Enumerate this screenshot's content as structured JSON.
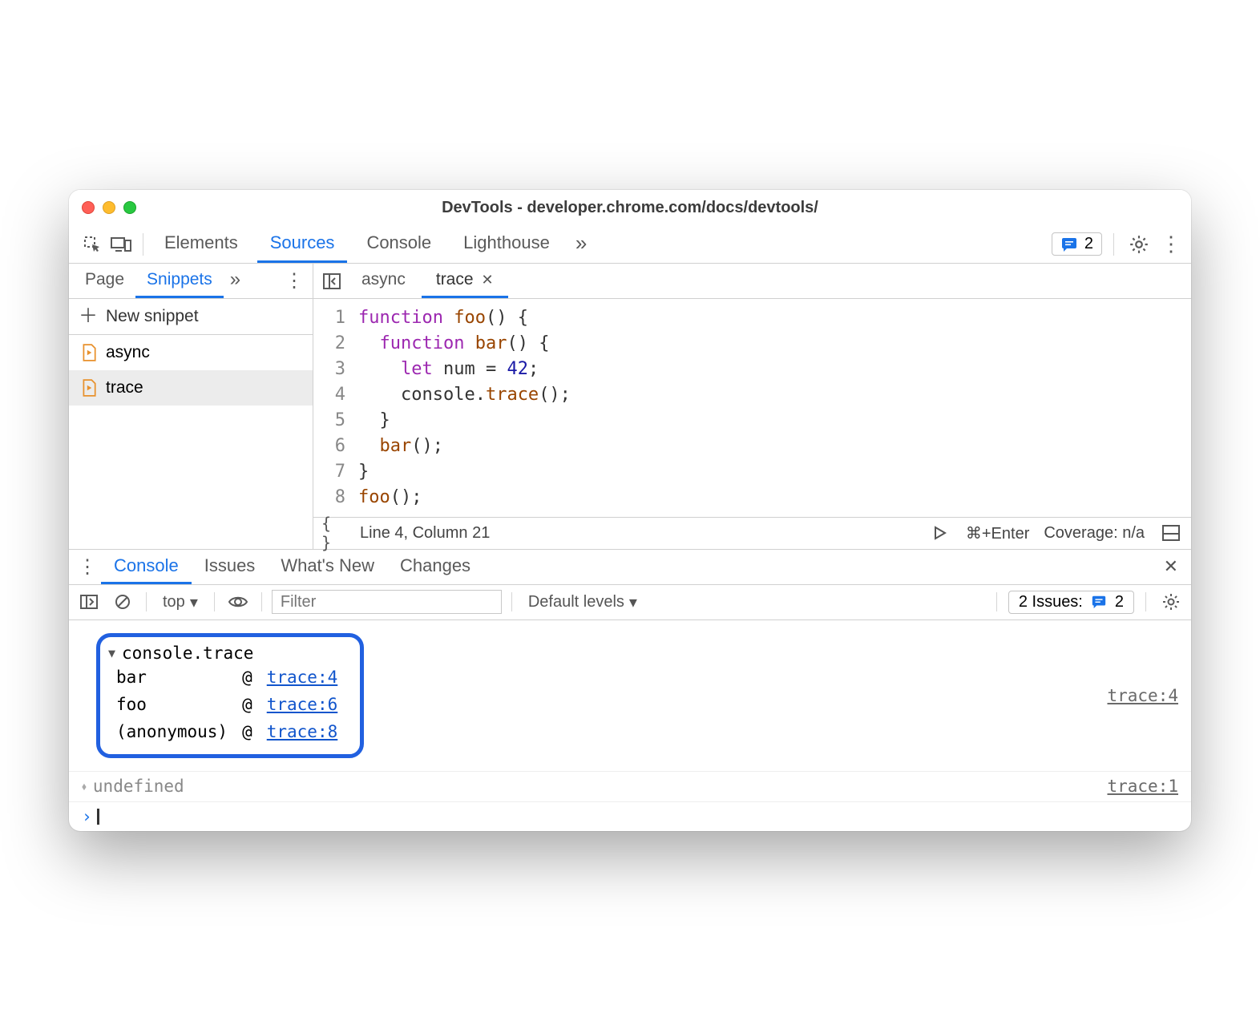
{
  "window": {
    "title": "DevTools - developer.chrome.com/docs/devtools/"
  },
  "toolbar": {
    "tabs": [
      "Elements",
      "Sources",
      "Console",
      "Lighthouse"
    ],
    "active": "Sources",
    "issues_count": "2"
  },
  "left": {
    "tabs": [
      "Page",
      "Snippets"
    ],
    "active": "Snippets",
    "new_snippet": "New snippet",
    "files": [
      {
        "name": "async",
        "selected": false
      },
      {
        "name": "trace",
        "selected": true
      }
    ]
  },
  "editor": {
    "tabs": [
      {
        "name": "async",
        "active": false,
        "closable": false
      },
      {
        "name": "trace",
        "active": true,
        "closable": true
      }
    ],
    "lines": [
      "function foo() {",
      "  function bar() {",
      "    let num = 42;",
      "    console.trace();",
      "  }",
      "  bar();",
      "}",
      "foo();"
    ],
    "cursor": "Line 4, Column 21",
    "run_shortcut": "⌘+Enter",
    "coverage": "Coverage: n/a"
  },
  "drawer": {
    "tabs": [
      "Console",
      "Issues",
      "What's New",
      "Changes"
    ],
    "active": "Console",
    "context": "top",
    "filter_placeholder": "Filter",
    "levels": "Default levels",
    "issues_label": "2 Issues:",
    "issues_count": "2"
  },
  "console": {
    "trace_label": "console.trace",
    "trace_source": "trace:4",
    "stack": [
      {
        "fn": "bar",
        "src": "trace:4"
      },
      {
        "fn": "foo",
        "src": "trace:6"
      },
      {
        "fn": "(anonymous)",
        "src": "trace:8"
      }
    ],
    "return_value": "undefined",
    "return_source": "trace:1"
  }
}
